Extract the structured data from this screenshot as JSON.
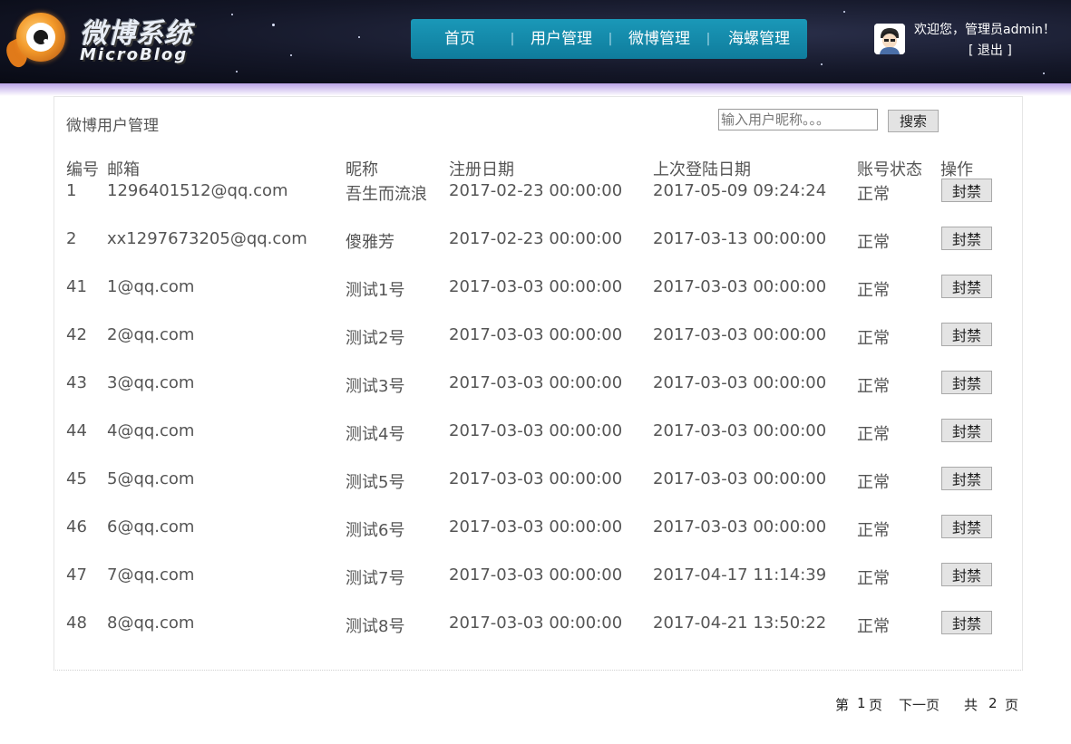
{
  "header": {
    "logo_title": "微博系统",
    "logo_subtitle": "MicroBlog",
    "nav": [
      {
        "label": "首页"
      },
      {
        "label": "用户管理"
      },
      {
        "label": "微博管理"
      },
      {
        "label": "海螺管理"
      }
    ],
    "welcome_text": "欢迎您，管理员admin！",
    "logout_label": "[ 退出 ]"
  },
  "panel": {
    "title": "微博用户管理",
    "search": {
      "placeholder": "输入用户昵称。。。",
      "value": "",
      "button_label": "搜索"
    }
  },
  "table": {
    "columns": [
      "编号",
      "邮箱",
      "昵称",
      "注册日期",
      "上次登陆日期",
      "账号状态",
      "操作"
    ],
    "rows": [
      {
        "id": "1",
        "email": "1296401512@qq.com",
        "nickname": "吾生而流浪",
        "reg_date": "2017-02-23 00:00:00",
        "last_login": "2017-05-09 09:24:24",
        "status": "正常",
        "action": "封禁"
      },
      {
        "id": "2",
        "email": "xx1297673205@qq.com",
        "nickname": "傻雅芳",
        "reg_date": "2017-02-23 00:00:00",
        "last_login": "2017-03-13 00:00:00",
        "status": "正常",
        "action": "封禁"
      },
      {
        "id": "41",
        "email": "1@qq.com",
        "nickname": "测试1号",
        "reg_date": "2017-03-03 00:00:00",
        "last_login": "2017-03-03 00:00:00",
        "status": "正常",
        "action": "封禁"
      },
      {
        "id": "42",
        "email": "2@qq.com",
        "nickname": "测试2号",
        "reg_date": "2017-03-03 00:00:00",
        "last_login": "2017-03-03 00:00:00",
        "status": "正常",
        "action": "封禁"
      },
      {
        "id": "43",
        "email": "3@qq.com",
        "nickname": "测试3号",
        "reg_date": "2017-03-03 00:00:00",
        "last_login": "2017-03-03 00:00:00",
        "status": "正常",
        "action": "封禁"
      },
      {
        "id": "44",
        "email": "4@qq.com",
        "nickname": "测试4号",
        "reg_date": "2017-03-03 00:00:00",
        "last_login": "2017-03-03 00:00:00",
        "status": "正常",
        "action": "封禁"
      },
      {
        "id": "45",
        "email": "5@qq.com",
        "nickname": "测试5号",
        "reg_date": "2017-03-03 00:00:00",
        "last_login": "2017-03-03 00:00:00",
        "status": "正常",
        "action": "封禁"
      },
      {
        "id": "46",
        "email": "6@qq.com",
        "nickname": "测试6号",
        "reg_date": "2017-03-03 00:00:00",
        "last_login": "2017-03-03 00:00:00",
        "status": "正常",
        "action": "封禁"
      },
      {
        "id": "47",
        "email": "7@qq.com",
        "nickname": "测试7号",
        "reg_date": "2017-03-03 00:00:00",
        "last_login": "2017-04-17 11:14:39",
        "status": "正常",
        "action": "封禁"
      },
      {
        "id": "48",
        "email": "8@qq.com",
        "nickname": "测试8号",
        "reg_date": "2017-03-03 00:00:00",
        "last_login": "2017-04-21 13:50:22",
        "status": "正常",
        "action": "封禁"
      }
    ]
  },
  "pager": {
    "prefix": "第",
    "current": "1",
    "page_unit": "页",
    "next_label": "下一页",
    "total_prefix": "共",
    "total": "2"
  },
  "icons": {
    "logo": "cartoon-eye-fish-icon",
    "avatar": "user-avatar-icon"
  }
}
